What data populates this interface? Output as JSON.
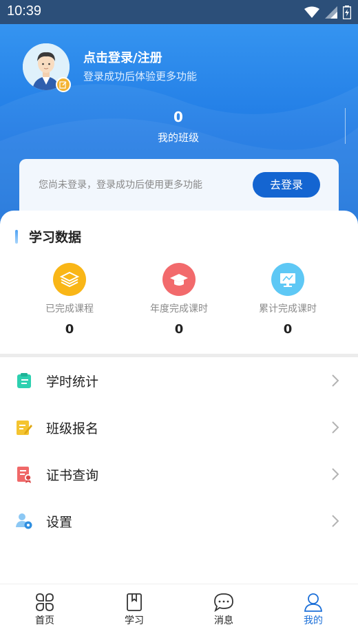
{
  "status_bar": {
    "time": "10:39"
  },
  "profile": {
    "login_title": "点击登录/注册",
    "login_subtitle": "登录成功后体验更多功能",
    "class_count": "0",
    "class_label": "我的班级"
  },
  "login_card": {
    "message": "您尚未登录，登录成功后使用更多功能",
    "button_label": "去登录"
  },
  "study_data": {
    "title": "学习数据",
    "stats": [
      {
        "label": "已完成课程",
        "value": "0",
        "icon": "layers-icon",
        "color": "#f9b617"
      },
      {
        "label": "年度完成课时",
        "value": "0",
        "icon": "graduation-cap-icon",
        "color": "#f26a6c"
      },
      {
        "label": "累计完成课时",
        "value": "0",
        "icon": "monitor-icon",
        "color": "#5ec8f5"
      }
    ]
  },
  "menu": [
    {
      "label": "学时统计",
      "icon": "clipboard-icon",
      "color": "#2dd0b0"
    },
    {
      "label": "班级报名",
      "icon": "edit-note-icon",
      "color": "#f4c431"
    },
    {
      "label": "证书查询",
      "icon": "certificate-icon",
      "color": "#f06868"
    },
    {
      "label": "设置",
      "icon": "user-settings-icon",
      "color": "#4aa7ee"
    }
  ],
  "tabs": [
    {
      "label": "首页",
      "icon": "home-grid-icon",
      "active": false
    },
    {
      "label": "学习",
      "icon": "book-icon",
      "active": false
    },
    {
      "label": "消息",
      "icon": "chat-bubble-icon",
      "active": false
    },
    {
      "label": "我的",
      "icon": "user-icon",
      "active": true
    }
  ],
  "colors": {
    "accent": "#1465d1",
    "active_tab": "#1b6fd8"
  }
}
